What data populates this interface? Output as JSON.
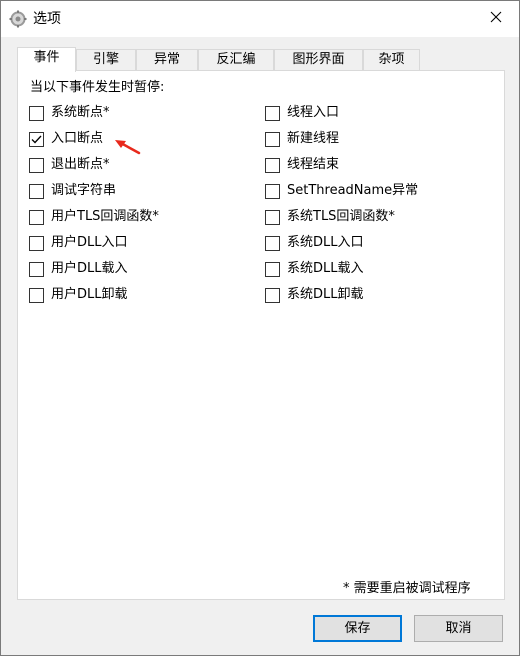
{
  "window": {
    "title": "选项",
    "title_icon": "gear-icon",
    "close_icon": "close-icon"
  },
  "tabs": [
    {
      "label": "事件",
      "active": true
    },
    {
      "label": "引擎",
      "active": false
    },
    {
      "label": "异常",
      "active": false
    },
    {
      "label": "反汇编",
      "active": false
    },
    {
      "label": "图形界面",
      "active": false
    },
    {
      "label": "杂项",
      "active": false
    }
  ],
  "events": {
    "heading": "当以下事件发生时暂停:",
    "left": [
      {
        "label": "系统断点*",
        "checked": false
      },
      {
        "label": "入口断点",
        "checked": true
      },
      {
        "label": "退出断点*",
        "checked": false
      },
      {
        "label": "调试字符串",
        "checked": false
      },
      {
        "label": "用户TLS回调函数*",
        "checked": false
      },
      {
        "label": "用户DLL入口",
        "checked": false
      },
      {
        "label": "用户DLL载入",
        "checked": false
      },
      {
        "label": "用户DLL卸载",
        "checked": false
      }
    ],
    "right": [
      {
        "label": "线程入口",
        "checked": false
      },
      {
        "label": "新建线程",
        "checked": false
      },
      {
        "label": "线程结束",
        "checked": false
      },
      {
        "label": "SetThreadName异常",
        "checked": false
      },
      {
        "label": "系统TLS回调函数*",
        "checked": false
      },
      {
        "label": "系统DLL入口",
        "checked": false
      },
      {
        "label": "系统DLL载入",
        "checked": false
      },
      {
        "label": "系统DLL卸载",
        "checked": false
      }
    ]
  },
  "note": "* 需要重启被调试程序",
  "buttons": {
    "save": "保存",
    "cancel": "取消"
  },
  "colors": {
    "accent": "#0078d7",
    "annotation_arrow": "#e8291c"
  }
}
